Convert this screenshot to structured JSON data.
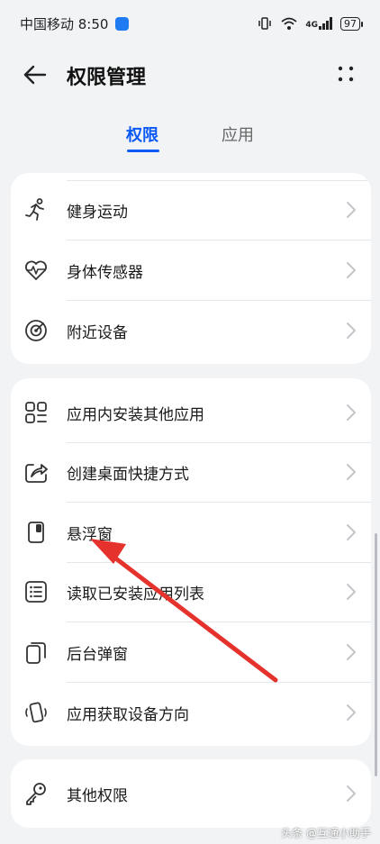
{
  "status_bar": {
    "carrier_time": "中国移动 8:50",
    "network": "4G",
    "battery": "97"
  },
  "header": {
    "title": "权限管理"
  },
  "tabs": [
    {
      "label": "权限",
      "active": true
    },
    {
      "label": "应用",
      "active": false
    }
  ],
  "group1": [
    {
      "label": "健身运动",
      "icon": "running-icon"
    },
    {
      "label": "身体传感器",
      "icon": "heart-pulse-icon"
    },
    {
      "label": "附近设备",
      "icon": "nearby-radar-icon"
    }
  ],
  "group2": [
    {
      "label": "应用内安装其他应用",
      "icon": "app-grid-icon"
    },
    {
      "label": "创建桌面快捷方式",
      "icon": "shortcut-share-icon"
    },
    {
      "label": "悬浮窗",
      "icon": "floating-window-icon"
    },
    {
      "label": "读取已安装应用列表",
      "icon": "list-icon"
    },
    {
      "label": "后台弹窗",
      "icon": "background-popup-icon"
    },
    {
      "label": "应用获取设备方向",
      "icon": "device-rotation-icon"
    }
  ],
  "group3": [
    {
      "label": "其他权限",
      "icon": "key-icon"
    }
  ],
  "watermark": "头条 @互通小助手",
  "colors": {
    "accent": "#0a59f7",
    "annotation": "#e5322d",
    "background": "#f1f3f5"
  }
}
